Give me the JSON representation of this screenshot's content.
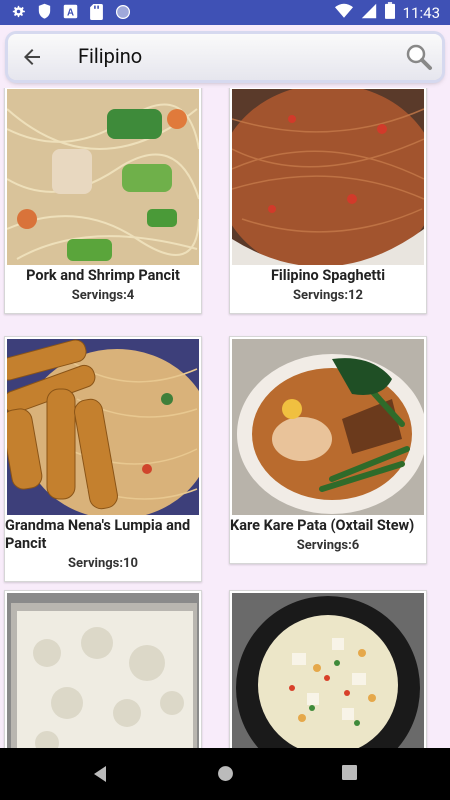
{
  "status_bar": {
    "time": "11:43",
    "icons": [
      "gear-icon",
      "shield-icon",
      "a-icon",
      "sd-card-icon",
      "circle-icon",
      "wifi-icon",
      "signal-icon",
      "battery-icon"
    ]
  },
  "search": {
    "query": "Filipino",
    "back_icon": "arrow-back-icon",
    "search_icon": "magnifier-icon"
  },
  "recipes": [
    {
      "name": "Pork and Shrimp Pancit",
      "servings": "Servings:4"
    },
    {
      "name": "Filipino Spaghetti",
      "servings": "Servings:12"
    },
    {
      "name": "Grandma Nena's Lumpia and Pancit",
      "servings": "Servings:10"
    },
    {
      "name": "Kare Kare Pata (Oxtail Stew)",
      "servings": "Servings:6"
    },
    {
      "name": "",
      "servings": ""
    },
    {
      "name": "",
      "servings": ""
    }
  ],
  "nav": {
    "back": "back-icon",
    "home": "home-icon",
    "recents": "recents-icon"
  },
  "colors": {
    "status_bar": "#3F51B5",
    "background": "#F8ECFA",
    "nav_bar": "#000000"
  }
}
